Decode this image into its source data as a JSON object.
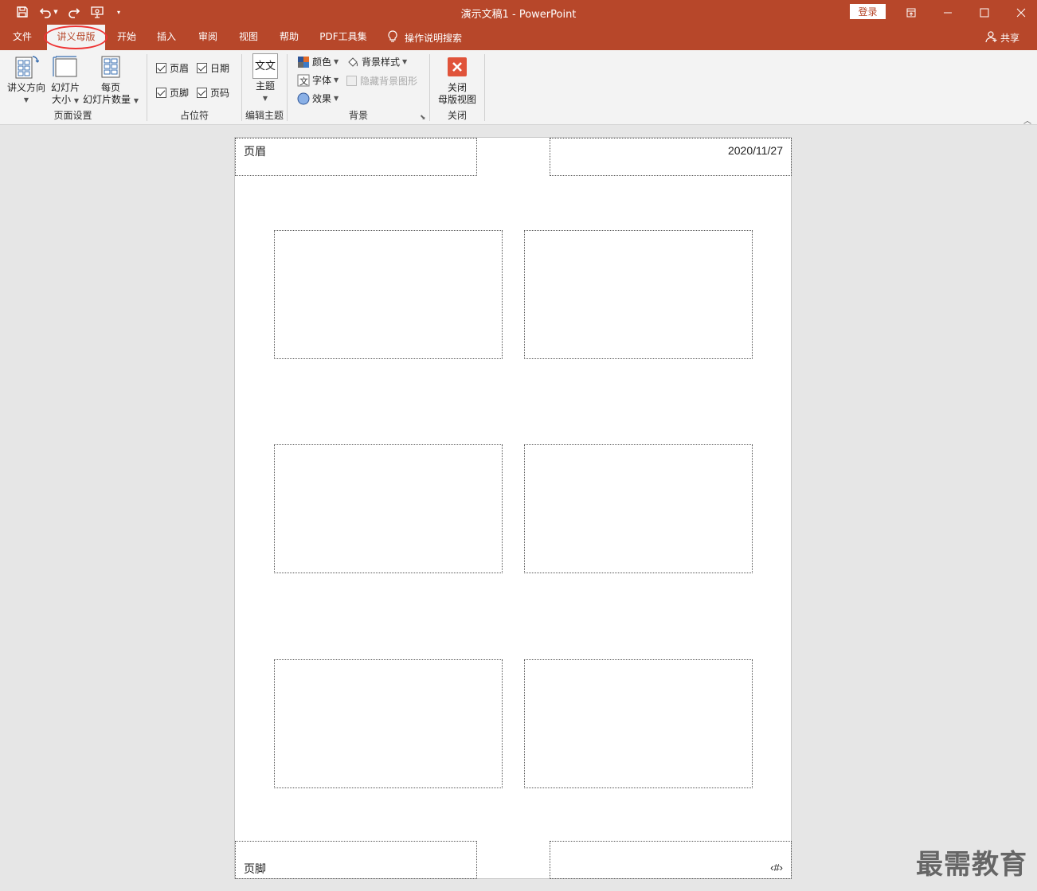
{
  "titlebar": {
    "title": "演示文稿1  -  PowerPoint",
    "login": "登录",
    "quick_access": [
      "save-icon",
      "undo-icon",
      "redo-icon",
      "start-from-beginning-icon",
      "customize-qat-icon"
    ]
  },
  "tabs": [
    {
      "label": "文件"
    },
    {
      "label": "讲义母版",
      "active": true
    },
    {
      "label": "开始"
    },
    {
      "label": "插入"
    },
    {
      "label": "审阅"
    },
    {
      "label": "视图"
    },
    {
      "label": "帮助"
    },
    {
      "label": "PDF工具集"
    }
  ],
  "tell_me": "操作说明搜索",
  "share": "共享",
  "ribbon": {
    "page_setup": {
      "label": "页面设置",
      "orientation": "讲义方向",
      "slide_size_1": "幻灯片",
      "slide_size_2": "大小",
      "slides_per_page_1": "每页",
      "slides_per_page_2": "幻灯片数量"
    },
    "placeholders": {
      "label": "占位符",
      "header": "页眉",
      "date": "日期",
      "footer": "页脚",
      "page_number": "页码"
    },
    "edit_theme": {
      "label": "编辑主题",
      "theme": "主题",
      "theme_icon_text": "文文"
    },
    "background": {
      "label": "背景",
      "colors": "颜色",
      "fonts": "字体",
      "effects": "效果",
      "background_styles": "背景样式",
      "hide_background_graphics": "隐藏背景图形"
    },
    "close": {
      "label": "关闭",
      "close_1": "关闭",
      "close_2": "母版视图"
    }
  },
  "handout": {
    "header": "页眉",
    "date": "2020/11/27",
    "footer": "页脚",
    "page_number": "‹#›",
    "slides_per_page": 6
  },
  "watermark": "最需教育",
  "colors": {
    "accent": "#b7472a",
    "ribbon_bg": "#f3f3f3",
    "workspace_bg": "#e6e6e6",
    "highlight_circle": "#e33333",
    "close_icon": "#e0533a"
  }
}
